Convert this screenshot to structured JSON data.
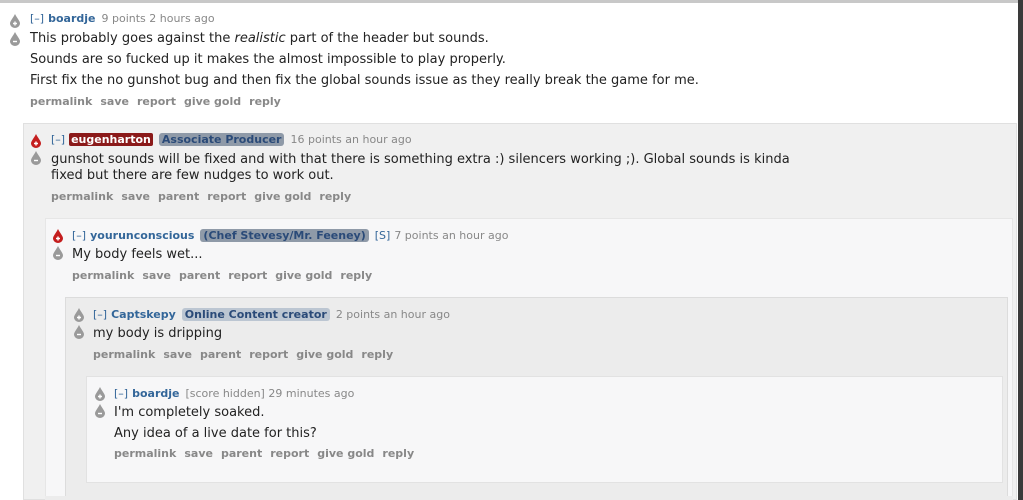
{
  "comments": [
    {
      "toggle": "[–]",
      "author": "boardje",
      "score": "9 points",
      "time": "2 hours ago",
      "lines": [
        {
          "before": "This probably goes against the ",
          "em": "realistic",
          "after": " part of the header but sounds."
        },
        {
          "text": "Sounds are so fucked up it makes the almost impossible to play properly."
        },
        {
          "text": "First fix the no gunshot bug and then fix the global sounds issue as they really break the game for me."
        }
      ],
      "links": [
        "permalink",
        "save",
        "report",
        "give gold",
        "reply"
      ]
    },
    {
      "toggle": "[–]",
      "author": "eugenharton",
      "flair": "Associate Producer",
      "score": "16 points",
      "time": "an hour ago",
      "text": "gunshot sounds will be fixed and with that there is something extra :) silencers working ;). Global sounds is kinda fixed but there are few nudges to work out.",
      "links": [
        "permalink",
        "save",
        "parent",
        "report",
        "give gold",
        "reply"
      ]
    },
    {
      "toggle": "[–]",
      "author": "yourunconscious",
      "flair": "(Chef Stevesy/Mr. Feeney)",
      "stamp": "[S]",
      "score": "7 points",
      "time": "an hour ago",
      "text": "My body feels wet...",
      "links": [
        "permalink",
        "save",
        "parent",
        "report",
        "give gold",
        "reply"
      ]
    },
    {
      "toggle": "[–]",
      "author": "Captskepy",
      "flair": "Online Content creator",
      "score": "2 points",
      "time": "an hour ago",
      "text": "my body is dripping",
      "links": [
        "permalink",
        "save",
        "parent",
        "report",
        "give gold",
        "reply"
      ]
    },
    {
      "toggle": "[–]",
      "author": "boardje",
      "score": "[score hidden]",
      "time": "29 minutes ago",
      "lines": [
        {
          "text": "I'm completely soaked."
        },
        {
          "text": "Any idea of a live date for this?"
        }
      ],
      "links": [
        "permalink",
        "save",
        "parent",
        "report",
        "give gold",
        "reply"
      ]
    }
  ],
  "colors": {
    "upvoted_arrow": "#c41e1e",
    "neutral_arrow": "#9a9a9a",
    "link": "#336699",
    "admin_bg": "#8b1a1a"
  },
  "icons": {
    "upvote": "upvote-drop-icon",
    "downvote": "downvote-drop-icon"
  }
}
